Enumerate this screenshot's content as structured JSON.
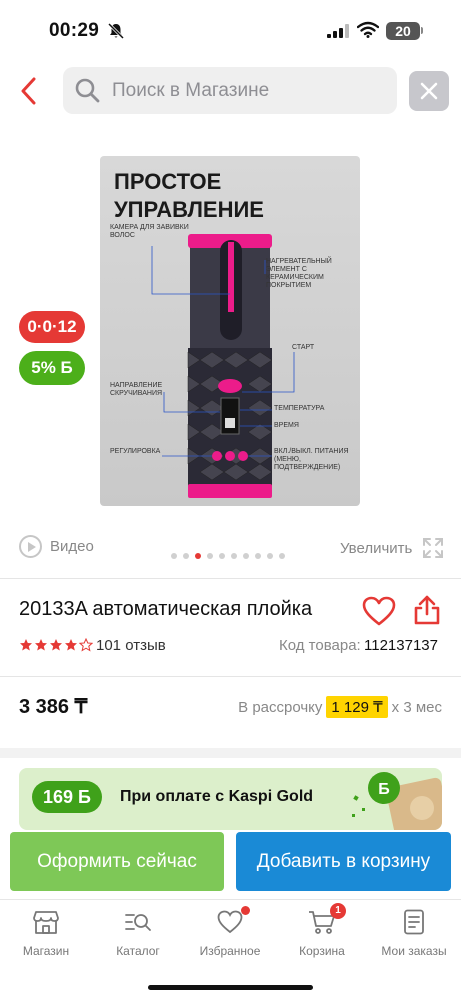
{
  "status_bar": {
    "time": "00:29",
    "battery": "20"
  },
  "search": {
    "placeholder": "Поиск в Магазине"
  },
  "product_image": {
    "title_line1": "ПРОСТОЕ",
    "title_line2": "УПРАВЛЕНИЕ",
    "labels": {
      "camera": "КАМЕРА ДЛЯ ЗАВИВКИ ВОЛОС",
      "heater": "НАГРЕВАТЕЛЬНЫЙ ЭЛЕМЕНТ С КЕРАМИЧЕСКИМ ПОКРЫТИЕМ",
      "start": "СТАРТ",
      "direction": "НАПРАВЛЕНИЕ СКРУЧИВАНИЯ",
      "temperature": "ТЕМПЕРАТУРА",
      "time": "ВРЕМЯ",
      "adjust": "РЕГУЛИРОВКА",
      "power": "ВКЛ./ВЫКЛ. ПИТАНИЯ (МЕНЮ, ПОДТВЕРЖДЕНИЕ)"
    }
  },
  "badges": {
    "installment": "0·0·12",
    "bonus": "5% Б"
  },
  "gallery": {
    "video_label": "Видео",
    "zoom_label": "Увеличить",
    "dots_total": 10,
    "dots_active_index": 2
  },
  "product": {
    "title": "20133A автоматическая плойка",
    "rating": 4,
    "reviews": "101 отзыв",
    "code_label": "Код товара:",
    "code_value": "112137137",
    "price": "3 386 ₸",
    "installment_prefix": "В рассрочку",
    "installment_amount": "1 129 ₸",
    "installment_suffix": "x 3 мес"
  },
  "gold_banner": {
    "bonus": "169 Б",
    "text": "При оплате с Kaspi Gold"
  },
  "actions": {
    "buy_now": "Оформить сейчас",
    "add_to_cart": "Добавить в корзину"
  },
  "tabs": [
    {
      "label": "Магазин",
      "icon": "store-icon"
    },
    {
      "label": "Каталог",
      "icon": "catalog-icon"
    },
    {
      "label": "Избранное",
      "icon": "heart-icon"
    },
    {
      "label": "Корзина",
      "icon": "cart-icon",
      "badge": "1"
    },
    {
      "label": "Мои заказы",
      "icon": "orders-icon"
    }
  ],
  "colors": {
    "accent_red": "#e53935",
    "green": "#4caf1a",
    "blue": "#1a8ad6",
    "yellow": "#ffd400"
  }
}
